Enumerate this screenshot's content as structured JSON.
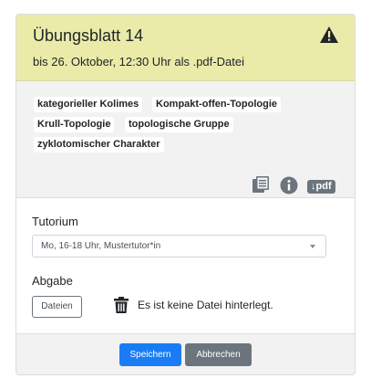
{
  "header": {
    "title": "Übungsblatt 14",
    "subtitle": "bis 26. Oktober, 12:30 Uhr als .pdf-Datei",
    "warning_icon": "warning-triangle-icon"
  },
  "tags": [
    "kategorieller Kolimes",
    "Kompakt-offen-Topologie",
    "Krull-Topologie",
    "topologische Gruppe",
    "zyklotomischer Charakter"
  ],
  "actions": {
    "files_icon": "documents-icon",
    "info_icon": "info-icon",
    "pdf_label": "↓pdf"
  },
  "form": {
    "tutorium_label": "Tutorium",
    "tutorium_value": "Mo, 16-18 Uhr, Mustertutor*in",
    "abgabe_label": "Abgabe",
    "files_button": "Dateien",
    "no_file_text": "Es ist keine Datei hinterlegt."
  },
  "footer": {
    "save_label": "Speichern",
    "cancel_label": "Abbrechen"
  },
  "colors": {
    "header_bg": "#eaeba8",
    "primary": "#1a7cf5",
    "secondary": "#6c757d"
  }
}
